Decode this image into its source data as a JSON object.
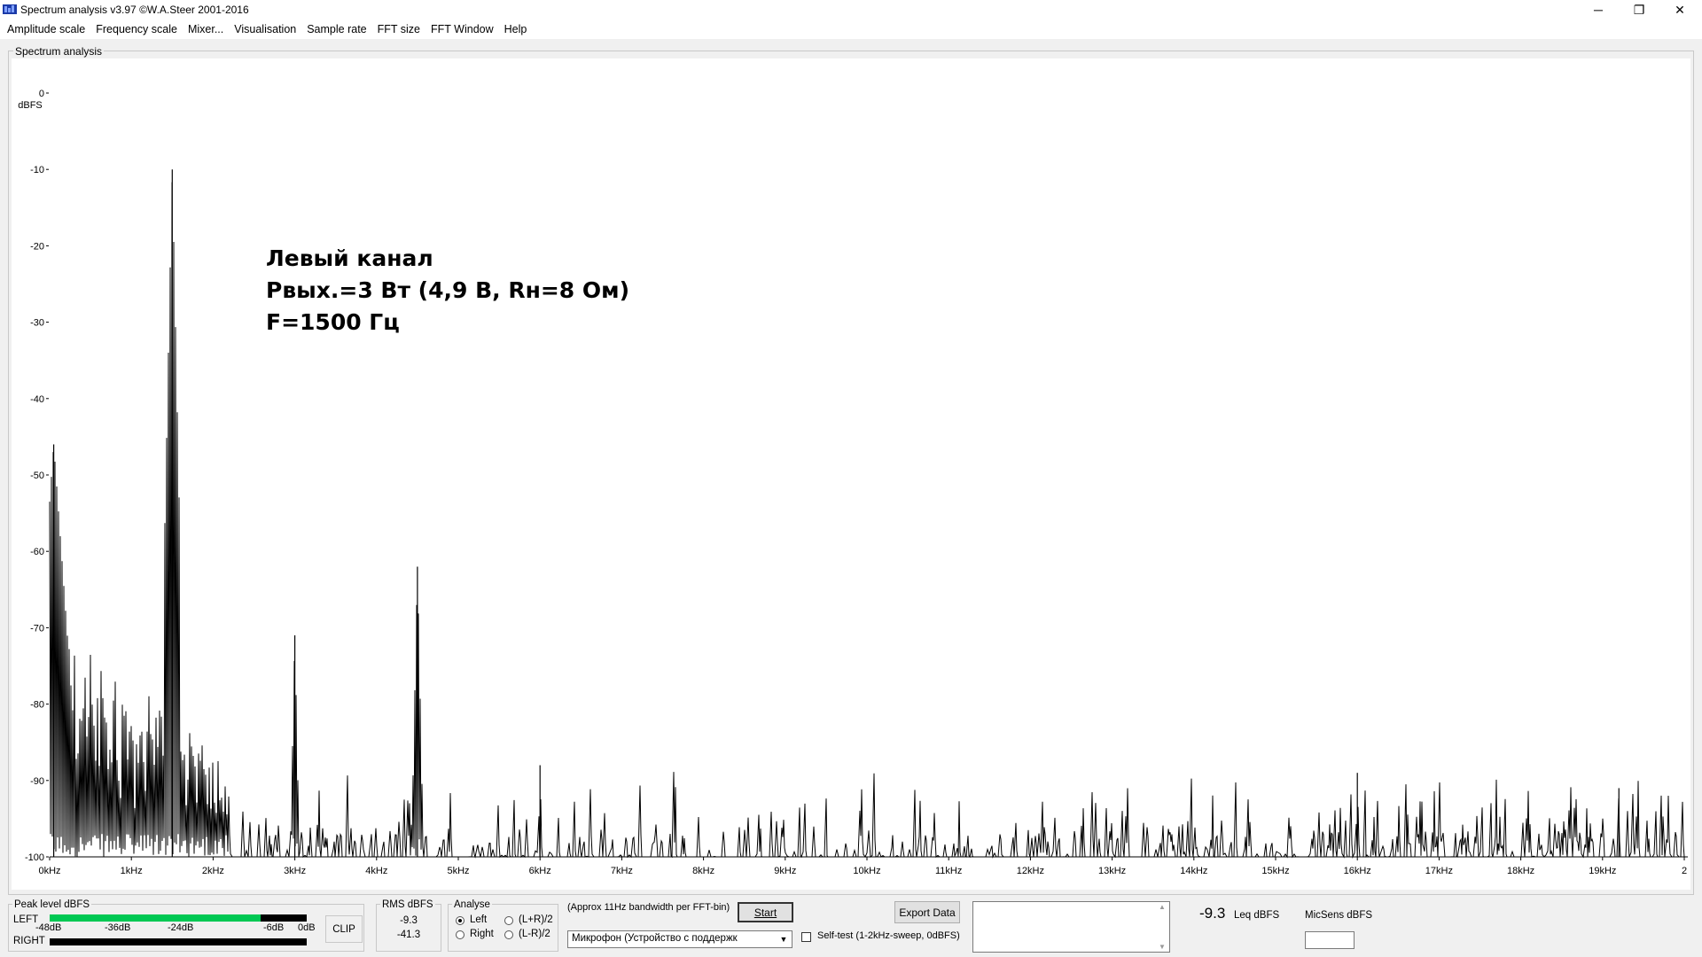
{
  "window": {
    "title": "Spectrum analysis v3.97  ©W.A.Steer 2001-2016",
    "minimize": "─",
    "maximize": "❐",
    "close": "✕"
  },
  "menu": [
    "Amplitude scale",
    "Frequency scale",
    "Mixer...",
    "Visualisation",
    "Sample rate",
    "FFT size",
    "FFT Window",
    "Help"
  ],
  "spectrum": {
    "group_label": "Spectrum analysis",
    "annotation": [
      "Левый канал",
      "Pвых.=3 Вт (4,9 В, Rн=8 Ом)",
      "F=1500 Гц"
    ]
  },
  "chart_data": {
    "type": "line",
    "title": "",
    "xlabel": "",
    "ylabel": "dBFS",
    "xlim": [
      0,
      20000
    ],
    "ylim": [
      -100,
      0
    ],
    "x_unit": "Hz",
    "y_ticks": [
      "0",
      "-10",
      "-20",
      "-30",
      "-40",
      "-50",
      "-60",
      "-70",
      "-80",
      "-90",
      "-100"
    ],
    "x_ticks": [
      "0kHz",
      "1kHz",
      "2kHz",
      "3kHz",
      "4kHz",
      "5kHz",
      "6kHz",
      "7kHz",
      "8kHz",
      "9kHz",
      "10kHz",
      "11kHz",
      "12kHz",
      "13kHz",
      "14kHz",
      "15kHz",
      "16kHz",
      "17kHz",
      "18kHz",
      "19kHz",
      "2"
    ],
    "grid": false,
    "noise_floor_dbfs": -100,
    "peaks": [
      {
        "freq_hz": 50,
        "dbfs": -46
      },
      {
        "freq_hz": 1500,
        "dbfs": -10
      },
      {
        "freq_hz": 3000,
        "dbfs": -71
      },
      {
        "freq_hz": 4500,
        "dbfs": -62
      },
      {
        "freq_hz": 6000,
        "dbfs": -88
      },
      {
        "freq_hz": 16000,
        "dbfs": -89
      },
      {
        "freq_hz": 19200,
        "dbfs": -91
      }
    ]
  },
  "peak_level": {
    "label": "Peak level dBFS",
    "left": "LEFT",
    "right": "RIGHT",
    "scale": [
      "-48dB",
      "-36dB",
      "-24dB",
      "-6dB",
      "0dB"
    ],
    "clip": "CLIP",
    "left_level_fraction": 0.82,
    "meter_color": "#00c853"
  },
  "rms": {
    "label": "RMS dBFS",
    "left": "-9.3",
    "right": "-41.3"
  },
  "analyse": {
    "label": "Analyse",
    "options": [
      "Left",
      "Right",
      "(L+R)/2",
      "(L-R)/2"
    ],
    "selected": "Left"
  },
  "bandwidth_note": "(Approx 11Hz bandwidth per FFT-bin)",
  "start_button": "Start",
  "device": "Микрофон (Устройство с поддержк",
  "self_test": "Self-test  (1-2kHz-sweep, 0dBFS)",
  "export_button": "Export Data",
  "leq": {
    "value": "-9.3",
    "label": "Leq dBFS"
  },
  "micsens": {
    "label": "MicSens dBFS",
    "value": ""
  }
}
